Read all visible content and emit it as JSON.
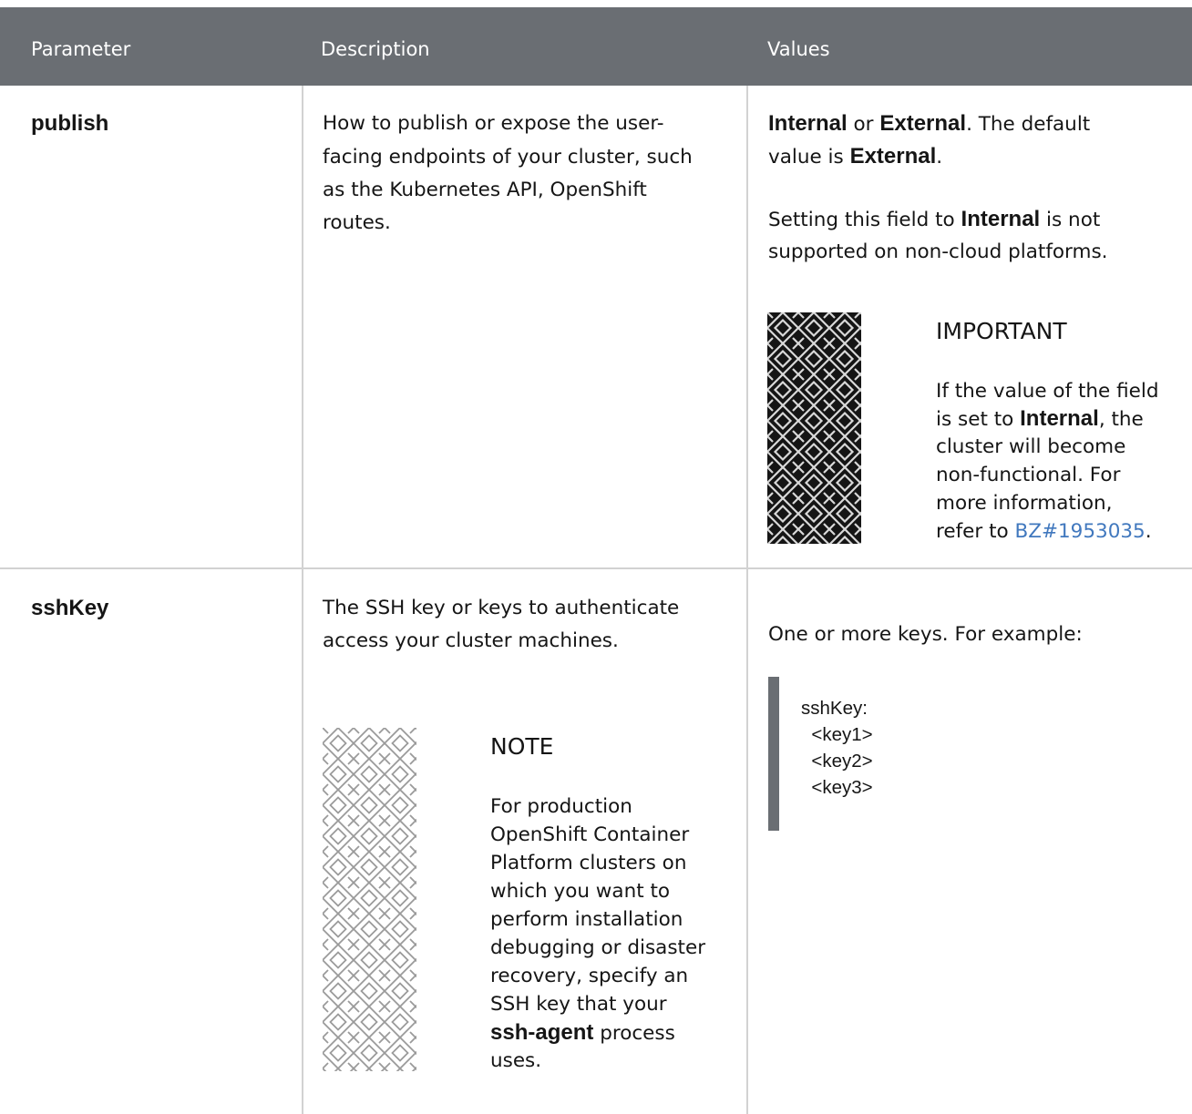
{
  "table": {
    "headers": [
      "Parameter",
      "Description",
      "Values"
    ]
  },
  "rows": [
    {
      "parameter": "publish",
      "description": "How to publish or expose the user-facing endpoints of your cluster, such as the Kubernetes API, OpenShift routes.",
      "description_lines": [
        "How to publish or expose the user-",
        "facing endpoints of your cluster, such",
        "as the Kubernetes API, OpenShift",
        "routes."
      ],
      "values": {
        "p1": {
          "bold1": "Internal",
          "or": " or ",
          "bold2": "External",
          "rest1": ". The default",
          "line2_pre": "value is ",
          "bold3": "External",
          "line2_post": "."
        },
        "p2": {
          "pre": "Setting this field to ",
          "bold": "Internal",
          "post": " is not",
          "line2": "supported on non-cloud platforms."
        },
        "admonition": {
          "icon": "important-pattern-icon",
          "title": "IMPORTANT",
          "line1": "If the value of the field",
          "line2_pre": "is set to ",
          "line2_bold": "Internal",
          "line2_post": ", the",
          "line3": "cluster will become",
          "line4": "non-functional. For",
          "line5": "more information,",
          "line6_pre": "refer to ",
          "link": "BZ#1953035",
          "line6_post": "."
        }
      }
    },
    {
      "parameter": "sshKey",
      "description_lines": [
        "The SSH key or keys to authenticate",
        "access your cluster machines."
      ],
      "admonition": {
        "icon": "note-pattern-icon",
        "title": "NOTE",
        "lines": [
          "For production",
          "OpenShift Container",
          "Platform clusters on",
          "which you want to",
          "perform installation",
          "debugging or disaster",
          "recovery, specify an",
          "SSH key that your"
        ],
        "last_bold": "ssh-agent",
        "last_post": " process",
        "final": "uses."
      },
      "values": {
        "intro": "One or more keys. For example:",
        "code": "sshKey:\n  <key1>\n  <key2>\n  <key3>"
      }
    }
  ],
  "colors": {
    "header_bg": "#6a6e73",
    "link": "#4178be",
    "border": "#d2d2d2"
  }
}
